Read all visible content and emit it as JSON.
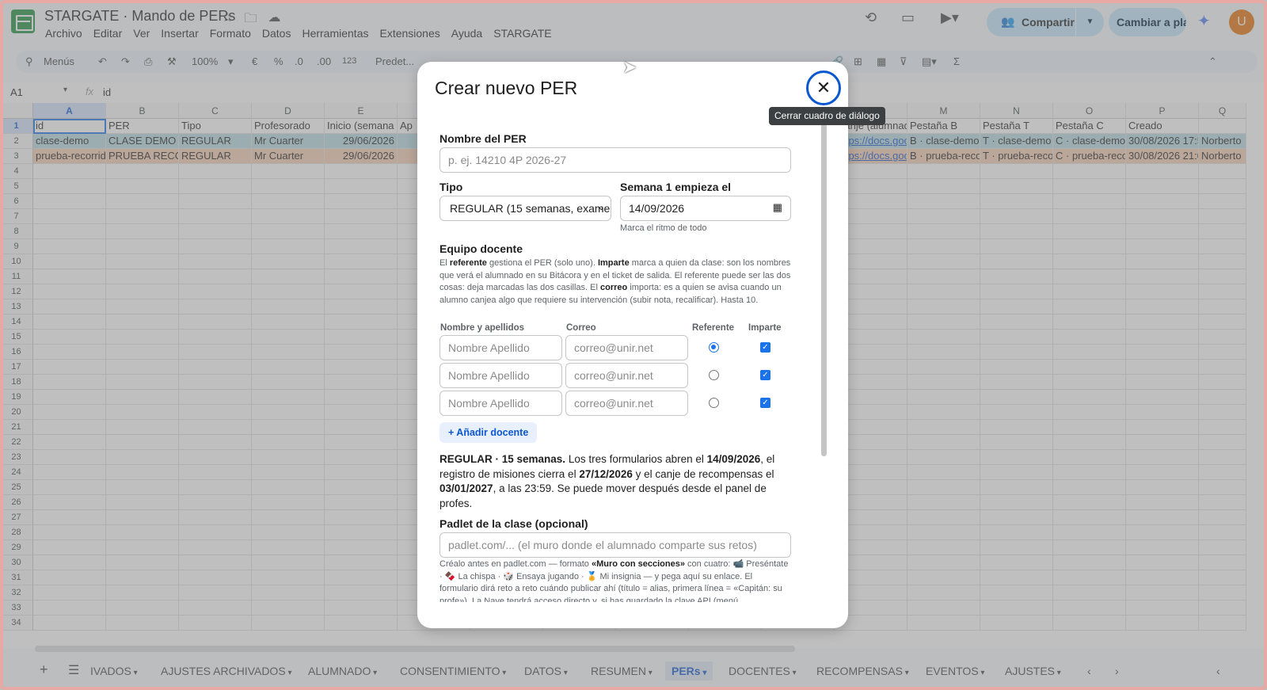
{
  "header": {
    "doc_title": "STARGATE · Mando de PERs",
    "menu": [
      "Archivo",
      "Editar",
      "Ver",
      "Insertar",
      "Formato",
      "Datos",
      "Herramientas",
      "Extensiones",
      "Ayuda",
      "STARGATE"
    ],
    "share_label": "Compartir",
    "switch_label": "Cambiar a pla...",
    "avatar_letter": "U"
  },
  "toolbar": {
    "search": "Menús",
    "zoom": "100%",
    "currency": "€",
    "percent": "%",
    "dec_less": ".0",
    "dec_more": ".00",
    "num_format": "123",
    "font": "Predet..."
  },
  "formula_bar": {
    "name_box": "A1",
    "fx": "fx",
    "value": "id"
  },
  "grid": {
    "columns": [
      "A",
      "B",
      "C",
      "D",
      "E",
      "F",
      "G",
      "H",
      "I",
      "J",
      "K",
      "L",
      "M",
      "N",
      "O",
      "P",
      "Q"
    ],
    "header_row": [
      "id",
      "PER",
      "Tipo",
      "Profesorado",
      "Inicio (semana 1",
      "Ap",
      "",
      "",
      "",
      "",
      "",
      "Canje (alumnado",
      "Pestaña B",
      "Pestaña T",
      "Pestaña C",
      "Creado",
      ""
    ],
    "row2": [
      "clase-demo",
      "CLASE DEMO",
      "REGULAR",
      "Mr Cuarter",
      "29/06/2026",
      "",
      "",
      "",
      "",
      "",
      "",
      "https://docs.goo",
      "B · clase-demo",
      "T · clase-demo",
      "C · clase-demo",
      "30/08/2026 17:5",
      "Norberto"
    ],
    "row3": [
      "prueba-recorrido",
      "PRUEBA RECO",
      "REGULAR",
      "Mr Cuarter",
      "29/06/2026",
      "",
      "",
      "",
      "",
      "",
      "",
      "https://docs.goo",
      "B · prueba-recor",
      "T · prueba-recor",
      "C · prueba-recor",
      "30/08/2026 21:0",
      "Norberto"
    ],
    "row_numbers": [
      "1",
      "2",
      "3",
      "4",
      "5",
      "6",
      "7",
      "8",
      "9",
      "10",
      "11",
      "12",
      "13",
      "14",
      "15",
      "16",
      "17",
      "18",
      "19",
      "20",
      "21",
      "22",
      "23",
      "24",
      "25",
      "26",
      "27",
      "28",
      "29",
      "30",
      "31",
      "32",
      "33",
      "34"
    ]
  },
  "dialog": {
    "title": "Crear nuevo PER",
    "close_tooltip": "Cerrar cuadro de diálogo",
    "name_label": "Nombre del PER",
    "name_placeholder": "p. ej. 14210 4P 2026-27",
    "type_label": "Tipo",
    "type_value": "REGULAR (15 semanas, exame",
    "week_label": "Semana 1 empieza el",
    "week_value": "14/09/2026",
    "week_hint": "Marca el ritmo de todo",
    "team_label": "Equipo docente",
    "team_desc": {
      "t1": "El ",
      "b1": "referente",
      "t2": " gestiona el PER (solo uno). ",
      "b2": "Imparte",
      "t3": " marca a quien da clase: son los nombres que verá el alumnado en su Bitácora y en el ticket de salida. El referente puede ser las dos cosas: deja marcadas las dos casillas. El ",
      "b3": "correo",
      "t4": " importa: es a quien se avisa cuando un alumno canjea algo que requiere su intervención (subir nota, recalificar). Hasta 10."
    },
    "cols": {
      "name": "Nombre y apellidos",
      "email": "Correo",
      "ref": "Referente",
      "teach": "Imparte"
    },
    "teachers": [
      {
        "name_ph": "Nombre Apellido",
        "email_ph": "correo@unir.net",
        "ref": true,
        "teach": true
      },
      {
        "name_ph": "Nombre Apellido",
        "email_ph": "correo@unir.net",
        "ref": false,
        "teach": true
      },
      {
        "name_ph": "Nombre Apellido",
        "email_ph": "correo@unir.net",
        "ref": false,
        "teach": true
      }
    ],
    "add_teacher": "+ Añadir docente",
    "summary": {
      "b1": "REGULAR · 15 semanas.",
      "t1": " Los tres formularios abren el ",
      "b2": "14/09/2026",
      "t2": ", el registro de misiones cierra el ",
      "b3": "27/12/2026",
      "t3": " y el canje de recompensas el ",
      "b4": "03/01/2027",
      "t4": ", a las 23:59. Se puede mover después desde el panel de profes."
    },
    "padlet_label": "Padlet de la clase (opcional)",
    "padlet_placeholder": "padlet.com/... (el muro donde el alumnado comparte sus retos)",
    "padlet_desc": {
      "t1": "Créalo antes en padlet.com — formato ",
      "b1": "«Muro con secciones»",
      "t2": " con cuatro: 📹 Preséntate · 🍫 La chispa · 🎲 Ensaya jugando · 🏅 Mi insignia — y pega aquí su enlace. El formulario dirá reto a reto cuándo publicar ahí (título = alias, primera línea = «Capitán: su profe»). La Nave tendrá acceso directo y, si has guardado la clave API (menú"
    }
  },
  "sheet_tabs": {
    "items": [
      "IVADOS",
      "AJUSTES ARCHIVADOS",
      "ALUMNADO",
      "CONSENTIMIENTO",
      "DATOS",
      "RESUMEN",
      "PERs",
      "DOCENTES",
      "RECOMPENSAS",
      "EVENTOS",
      "AJUSTES"
    ],
    "active": "PERs",
    "colors": [
      "#c2185b",
      "#e91e63",
      "#f57c00",
      "#4db6ac",
      "#ff9800",
      "#9e9e9e",
      "#3f51b5",
      "#9e9e9e",
      "#ab47bc",
      "#8bc34a",
      "#7cb342"
    ]
  }
}
